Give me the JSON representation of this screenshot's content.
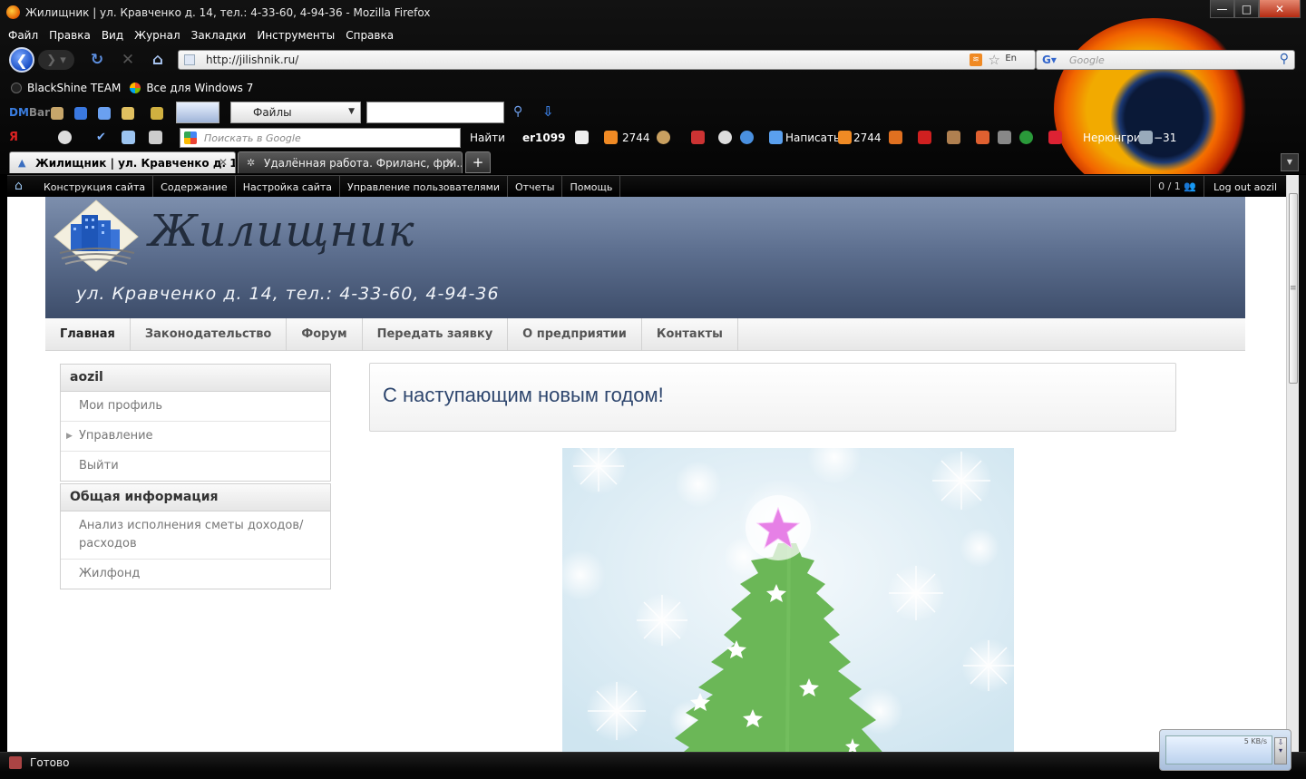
{
  "window": {
    "title": "Жилищник | ул. Кравченко д. 14, тел.: 4-33-60, 4-94-36 - Mozilla Firefox",
    "buttons": {
      "minimize": "—",
      "maximize": "□",
      "close": "✕"
    }
  },
  "menu": [
    "Файл",
    "Правка",
    "Вид",
    "Журнал",
    "Закладки",
    "Инструменты",
    "Справка"
  ],
  "navbar": {
    "url": "http://jilishnik.ru/",
    "lang_indicator": "En",
    "search_placeholder": "Google"
  },
  "bookmarks": [
    {
      "label": "BlackShine TEAM"
    },
    {
      "label": "Все для Windows 7"
    }
  ],
  "dmbar": {
    "logo_dm": "DM",
    "logo_bar": "Bar",
    "files_label": "Файлы"
  },
  "yandex_bar": {
    "logo": "Я",
    "search_placeholder": "Поискать в Google",
    "find_label": "Найти",
    "user": "er1099",
    "mail_count_1": "2744",
    "write_label": "Написать",
    "mail_count_2": "2744",
    "city": "Нерюнгри",
    "temperature": "−31"
  },
  "tabs": [
    {
      "title": "Жилищник | ул. Кравченко д. 1...",
      "active": true
    },
    {
      "title": "Удалённая работа. Фриланс, фри...",
      "active": false
    }
  ],
  "new_tab_label": "+",
  "admin_menu": {
    "links": [
      "Конструкция сайта",
      "Содержание",
      "Настройка сайта",
      "Управление пользователями",
      "Отчеты",
      "Помощь"
    ],
    "counter": "0 / 1",
    "logout": "Log out aozil"
  },
  "site": {
    "name": "Жилищник",
    "slogan": "ул. Кравченко д. 14, тел.: 4-33-60, 4-94-36",
    "primary_nav": [
      "Главная",
      "Законодательство",
      "Форум",
      "Передать заявку",
      "О предприятии",
      "Контакты"
    ],
    "user_block": {
      "title": "aozil",
      "items": [
        "Мои профиль",
        "Управление",
        "Выйти"
      ]
    },
    "info_block": {
      "title": "Общая информация",
      "items": [
        "Анализ исполнения сметы доходов/расходов",
        "Жилфонд"
      ]
    },
    "content_title": "С наступающим новым годом!"
  },
  "statusbar": {
    "text": "Готово",
    "download_speed": "5 KB/s"
  },
  "colors": {
    "header_top": "#7d8fad",
    "header_bottom": "#3d4d6a",
    "title_blue": "#2e466e",
    "tree_green": "#6bb757",
    "star_pink": "#e680e6"
  }
}
